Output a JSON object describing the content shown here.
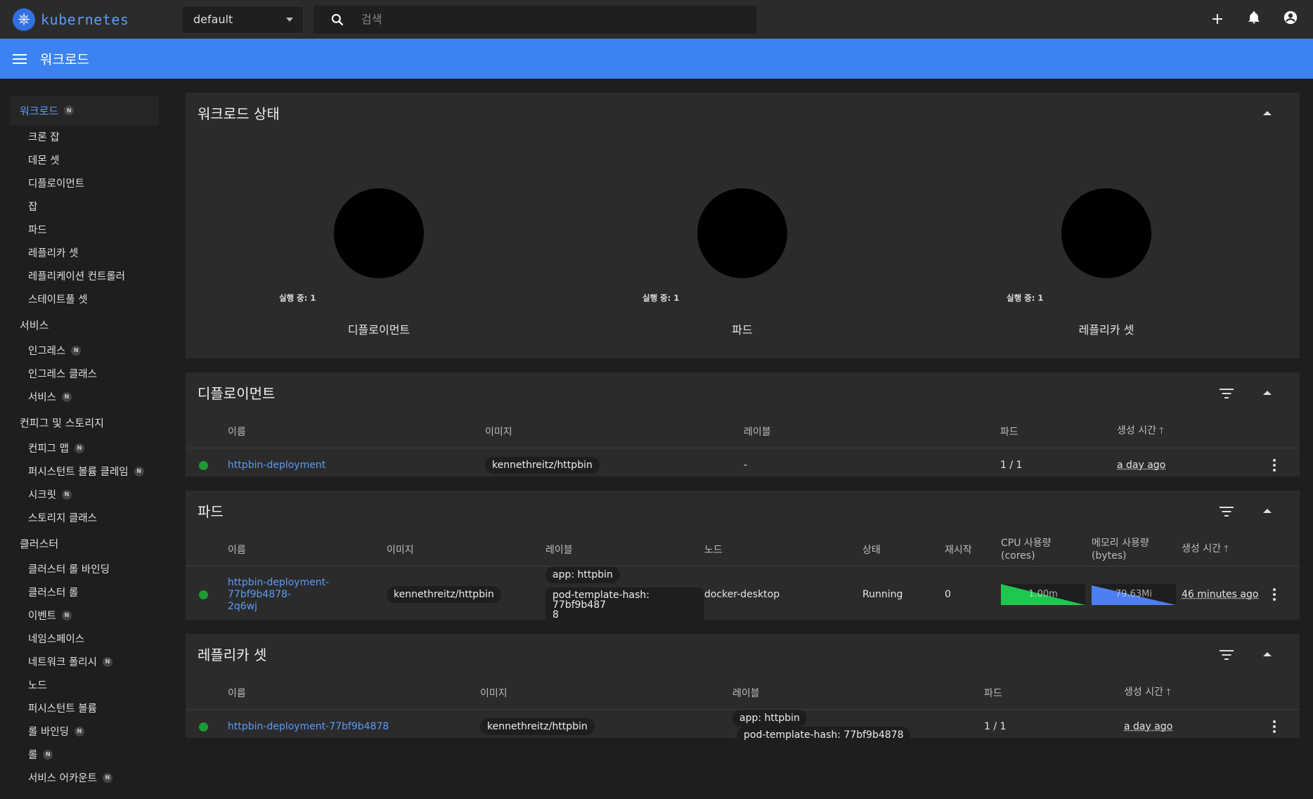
{
  "topbar": {
    "logo_text": "kubernetes",
    "namespace": "default",
    "search_placeholder": "검색"
  },
  "breadcrumb": {
    "title": "워크로드"
  },
  "sidebar": {
    "workloads_label": "워크로드",
    "workload_items": [
      "크론 잡",
      "데몬 셋",
      "디플로이먼트",
      "잡",
      "파드",
      "레플리카 셋",
      "레플리케이션 컨트롤러",
      "스테이트풀 셋"
    ],
    "services_label": "서비스",
    "service_items": [
      "인그레스",
      "인그레스 클래스",
      "서비스"
    ],
    "config_label": "컨피그 및 스토리지",
    "config_items": [
      "컨피그 맵",
      "퍼시스턴트 볼륨 클레임",
      "시크릿",
      "스토리지 클래스"
    ],
    "cluster_label": "클러스터",
    "cluster_items": [
      "클러스터 롤 바인딩",
      "클러스터 롤",
      "이벤트",
      "네임스페이스",
      "네트워크 폴리시",
      "노드",
      "퍼시스턴트 볼륨",
      "롤 바인딩",
      "롤",
      "서비스 어카운트"
    ],
    "badge": "N"
  },
  "status": {
    "title": "워크로드 상태",
    "charts": [
      {
        "legend": "실행 중: 1",
        "label": "디플로이먼트"
      },
      {
        "legend": "실행 중: 1",
        "label": "파드"
      },
      {
        "legend": "실행 중: 1",
        "label": "레플리카 셋"
      }
    ]
  },
  "deployments": {
    "title": "디플로이먼트",
    "headers": [
      "이름",
      "이미지",
      "레이블",
      "파드",
      "생성 시간"
    ],
    "row": {
      "name": "httpbin-deployment",
      "image": "kennethreitz/httpbin",
      "labels": "-",
      "pods": "1 / 1",
      "age": "a day ago"
    }
  },
  "pods": {
    "title": "파드",
    "headers": [
      "이름",
      "이미지",
      "레이블",
      "노드",
      "상태",
      "재시작",
      "CPU 사용량",
      "(cores)",
      "메모리 사용량",
      "(bytes)",
      "생성 시간"
    ],
    "row": {
      "name_line1": "httpbin-deployment-77bf9b4878-",
      "name_line2": "2q6wj",
      "image": "kennethreitz/httpbin",
      "label1": "app: httpbin",
      "label2_line1": "pod-template-hash: 77bf9b487",
      "label2_line2": "8",
      "node": "docker-desktop",
      "status": "Running",
      "restarts": "0",
      "cpu": "1.00m",
      "memory": "79.63Mi",
      "age": "46 minutes ago"
    }
  },
  "replicasets": {
    "title": "레플리카 셋",
    "headers": [
      "이름",
      "이미지",
      "레이블",
      "파드",
      "생성 시간"
    ],
    "row": {
      "name": "httpbin-deployment-77bf9b4878",
      "image": "kennethreitz/httpbin",
      "label1": "app: httpbin",
      "label2": "pod-template-hash: 77bf9b4878",
      "pods": "1 / 1",
      "age": "a day ago"
    }
  },
  "colors": {
    "accent": "#3c82f0",
    "running": "#1e9a35",
    "cpu_spark": "#1ec74f",
    "mem_spark": "#4d7ff0"
  }
}
